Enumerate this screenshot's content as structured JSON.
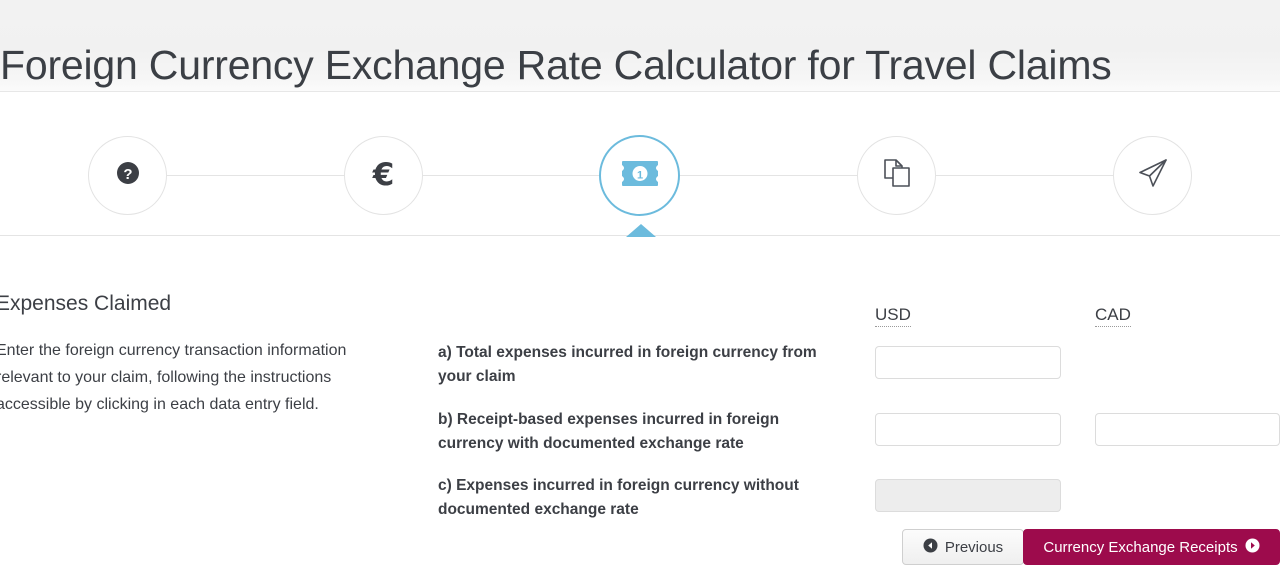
{
  "header": {
    "title": "Foreign Currency Exchange Rate Calculator for Travel Claims"
  },
  "stepper": {
    "active_index": 2,
    "active_color": "#6cbbdd",
    "inactive_border_color": "#e3e3e3",
    "steps": [
      {
        "icon": "question-mark-circle-icon",
        "state": "complete"
      },
      {
        "icon": "euro-sign-icon",
        "state": "complete",
        "glyph": "€"
      },
      {
        "icon": "banknote-money-icon",
        "state": "active"
      },
      {
        "icon": "copy-documents-icon",
        "state": "upcoming"
      },
      {
        "icon": "paper-plane-send-icon",
        "state": "upcoming"
      }
    ]
  },
  "intro": {
    "heading": "Expenses Claimed",
    "body": "Enter the foreign currency transaction information relevant to your claim, following the instructions accessible by clicking in each data entry field."
  },
  "form": {
    "columns": [
      {
        "id": "usd",
        "label": "USD"
      },
      {
        "id": "cad",
        "label": "CAD"
      }
    ],
    "rows": [
      {
        "id": "row-a",
        "label": "a) Total expenses incurred in foreign currency from your claim",
        "usd": {
          "value": "",
          "placeholder": "",
          "enabled": true
        },
        "cad": {
          "present": false
        }
      },
      {
        "id": "row-b",
        "label": "b) Receipt-based expenses incurred in foreign currency with documented exchange rate",
        "usd": {
          "value": "",
          "placeholder": "",
          "enabled": true
        },
        "cad": {
          "present": true,
          "value": "",
          "placeholder": "",
          "enabled": true
        }
      },
      {
        "id": "row-c",
        "label": "c) Expenses incurred in foreign currency without documented exchange rate",
        "usd": {
          "value": "",
          "placeholder": "",
          "enabled": false
        },
        "cad": {
          "present": false
        }
      }
    ]
  },
  "buttons": {
    "previous": {
      "label": "Previous",
      "icon": "arrow-circle-left-icon"
    },
    "next": {
      "label": "Currency Exchange Receipts",
      "icon": "arrow-circle-right-icon",
      "color": "#9d0b4c"
    }
  }
}
